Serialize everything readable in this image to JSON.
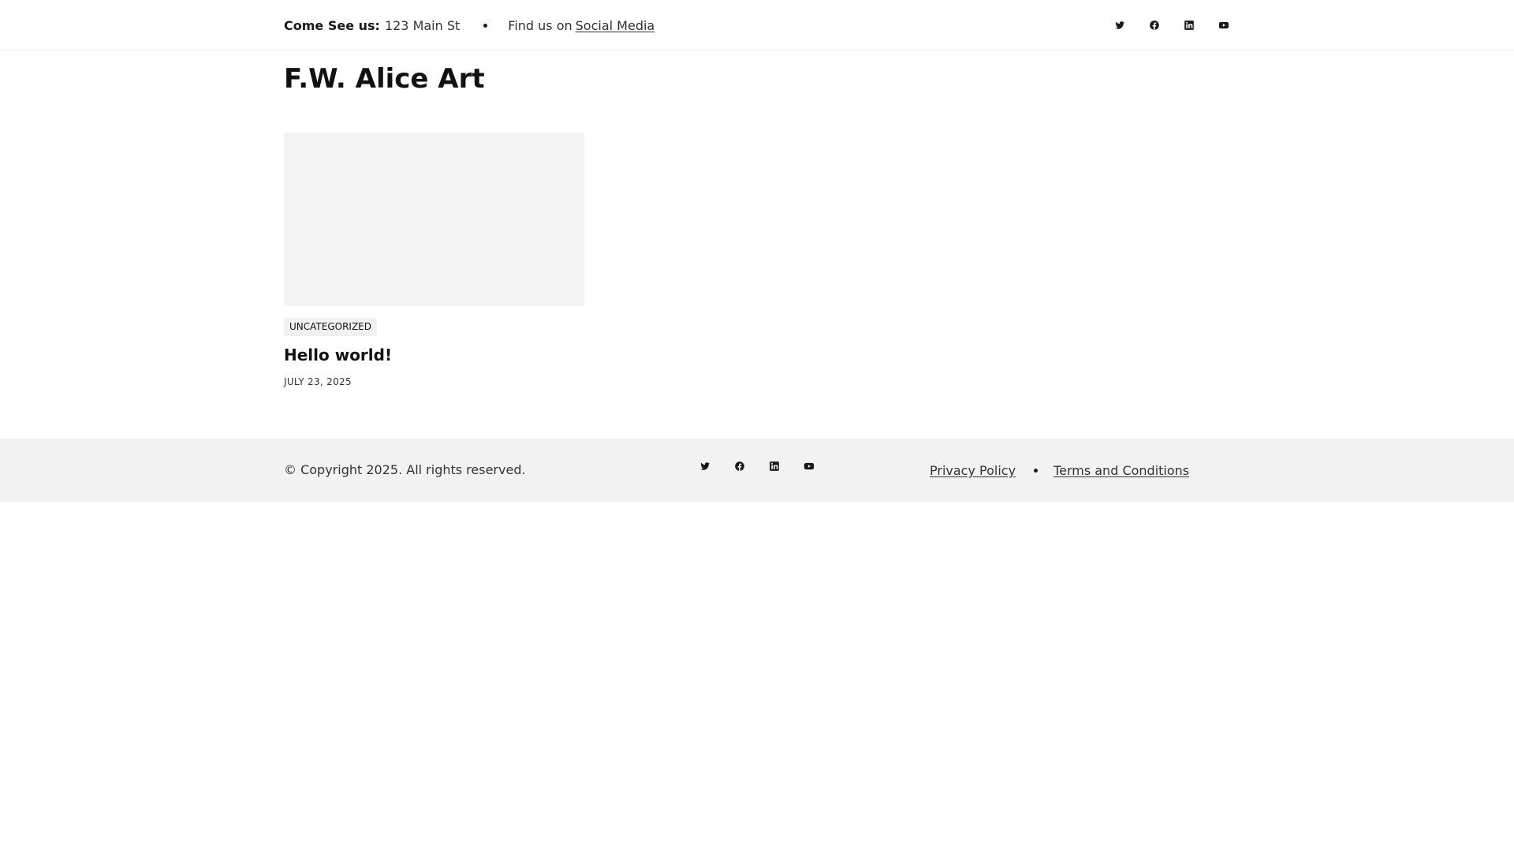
{
  "topbar": {
    "address_label": "Come See us:",
    "address_value": "123 Main St",
    "find_text": "Find us on",
    "social_link": "Social Media"
  },
  "social_icons": [
    "twitter-icon",
    "facebook-icon",
    "linkedin-icon",
    "youtube-icon"
  ],
  "site": {
    "title": "F.W. Alice Art"
  },
  "post": {
    "category": "UNCATEGORIZED",
    "title": "Hello world!",
    "date": "JULY 23, 2025"
  },
  "footer": {
    "copyright": "© Copyright 2025. All rights reserved.",
    "privacy": "Privacy Policy",
    "terms": "Terms and Conditions"
  },
  "colors": {
    "text": "#1a1a1a",
    "muted": "#333333",
    "thumb_bg": "#f3f3f3",
    "footer_bg": "#f2f2f2",
    "border": "#ececec"
  }
}
